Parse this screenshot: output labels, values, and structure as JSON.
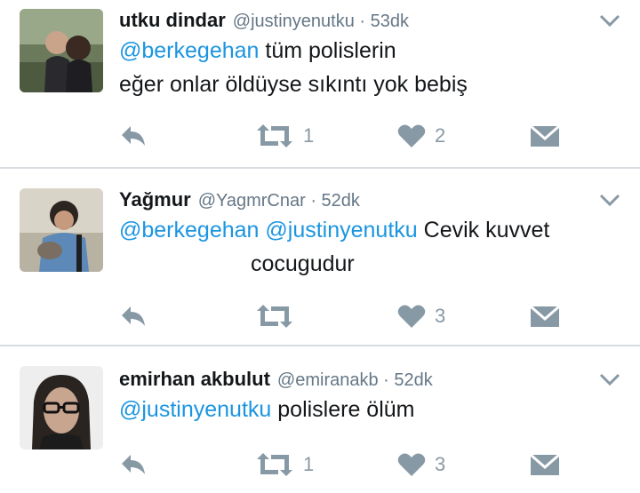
{
  "tweets": [
    {
      "name": "utku dindar",
      "handle": "@justinyenutku · 53dk",
      "line1_mention": "@berkegehan",
      "line1_text": " tüm polislerin",
      "line2_text": "eğer onlar öldüyse sıkıntı yok bebiş",
      "retweets": "1",
      "likes": "2"
    },
    {
      "name": "Yağmur",
      "handle": "@YagmrCnar · 52dk",
      "line1_mention": "@berkegehan @justinyenutku",
      "line1_text": " Cevik kuvvet",
      "line2_text": "cocugudur",
      "retweets": "",
      "likes": "3"
    },
    {
      "name": "emirhan akbulut",
      "handle": "@emiranakb · 52dk",
      "line1_mention": "@justinyenutku",
      "line1_text": " polislere ölüm",
      "retweets": "1",
      "likes": "3"
    }
  ],
  "icons": {
    "reply": "reply-icon",
    "retweet": "retweet-icon",
    "like": "heart-icon",
    "message": "direct-message-icon",
    "more": "chevron-down-icon"
  },
  "colors": {
    "mention": "#1b95e0",
    "icon": "#8899a6",
    "handle": "#657786",
    "divider": "#d8dde2"
  }
}
